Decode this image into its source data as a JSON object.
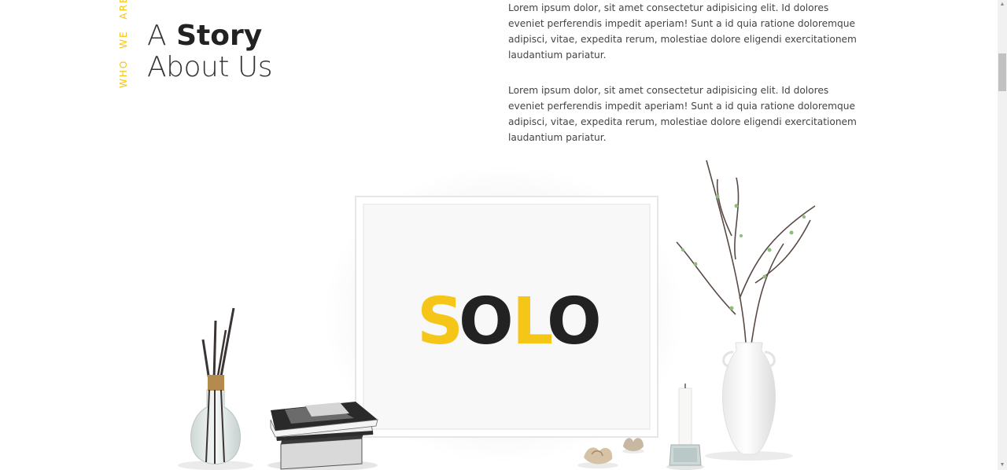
{
  "section": {
    "tag_words": "WHO WE ARE",
    "heading": {
      "light": "A",
      "bold": "Story",
      "line2": "About Us"
    },
    "paragraphs": [
      "Lorem ipsum dolor, sit amet consectetur adipisicing elit. Id dolores eveniet perferendis impedit aperiam! Sunt a id quia ratione doloremque adipisci, vitae, expedita rerum, molestiae dolore eligendi exercitationem laudantium pariatur.",
      "Lorem ipsum dolor, sit amet consectetur adipisicing elit. Id dolores eveniet perferendis impedit aperiam! Sunt a id quia ratione doloremque adipisci, vitae, expedita rerum, molestiae dolore eligendi exercitationem laudantium pariatur."
    ]
  },
  "frame": {
    "letters": [
      "S",
      "O",
      "L",
      "O"
    ]
  },
  "colors": {
    "accent": "#f5c518",
    "dark": "#222222"
  },
  "icons": {
    "scroll_down": "triangle-down-icon"
  }
}
